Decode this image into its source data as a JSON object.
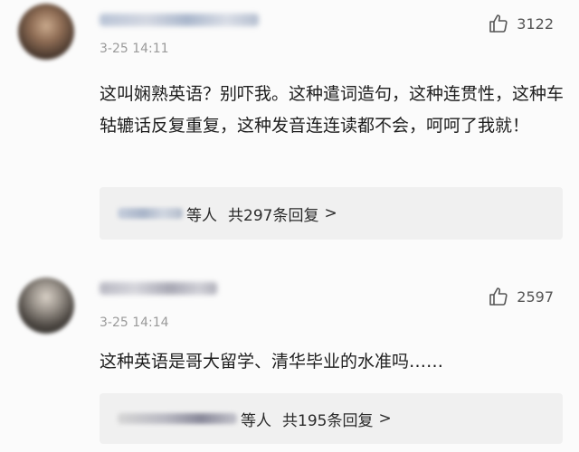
{
  "comments": [
    {
      "timestamp": "3-25 14:11",
      "likes": "3122",
      "text": "这叫娴熟英语？别吓我。这种遣词造句，这种连贯性，这种车轱辘话反复重复，这种发音连连读都不会，呵呵了我就！",
      "reply_suffix": "等人",
      "reply_count": "共297条回复",
      "reply_chevron": ">"
    },
    {
      "timestamp": "3-25 14:14",
      "likes": "2597",
      "text": "这种英语是哥大留学、清华毕业的水准吗……",
      "reply_suffix": "等人",
      "reply_count": "共195条回复",
      "reply_chevron": ">"
    }
  ],
  "icons": {
    "like": "thumbs-up-icon"
  },
  "colors": {
    "background": "#fbfbfb",
    "timestamp": "#9a9a9a",
    "reply_box": "#f0f0f0",
    "text": "#1e1e1e"
  }
}
